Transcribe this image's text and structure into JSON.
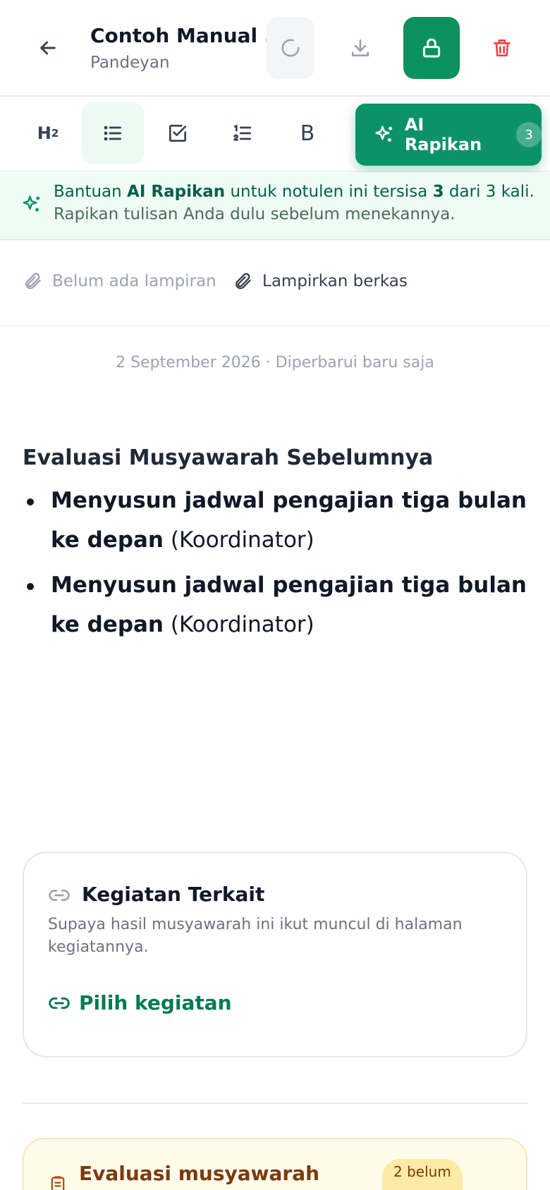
{
  "header": {
    "title": "Contoh Manual ...",
    "subtitle": "Pandeyan"
  },
  "toolbar": {
    "heading_label": "H",
    "heading_sub": "2",
    "bold_label": "B",
    "ai_button_label": "AI Rapikan",
    "ai_count": "3"
  },
  "ai_banner": {
    "prefix": "Bantuan ",
    "brand": "AI Rapikan",
    "middle": " untuk notulen ini tersisa ",
    "remaining": "3",
    "suffix": " dari 3 kali.",
    "line2": "Rapikan tulisan Anda dulu sebelum menekannya."
  },
  "attachments": {
    "empty_label": "Belum ada lampiran",
    "attach_button": "Lampirkan berkas"
  },
  "meta": "2 September 2026 · Diperbarui baru saja",
  "note": {
    "heading": "Evaluasi Musyawarah Sebelumnya",
    "items": [
      {
        "strong": "Menyusun jadwal pengajian tiga bulan ke depan",
        "plain": " (Koordinator)"
      },
      {
        "strong": "Menyusun jadwal pengajian tiga bulan ke depan",
        "plain": " (Koordinator)"
      }
    ]
  },
  "related": {
    "title": "Kegiatan Terkait",
    "description": "Supaya hasil musyawarah ini ikut muncul di halaman kegiatannya.",
    "pick_label": "Pilih kegiatan"
  },
  "evaluation": {
    "title": "Evaluasi musyawarah",
    "badge": "2 belum"
  },
  "colors": {
    "brand_green": "#0c9268",
    "danger_red": "#ef4444",
    "amber_bg": "#fffbeb"
  }
}
